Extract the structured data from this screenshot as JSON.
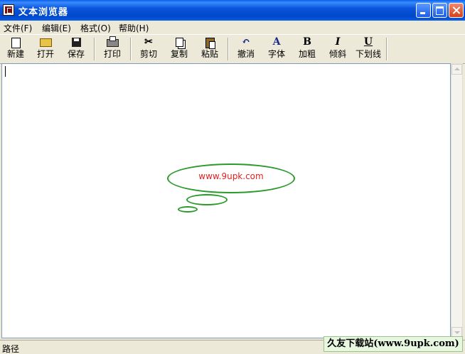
{
  "window": {
    "title": "文本浏览器",
    "icon": "app-icon"
  },
  "menubar": {
    "items": [
      {
        "label": "文件(F)"
      },
      {
        "label": "编辑(E)"
      },
      {
        "label": "格式(O)"
      },
      {
        "label": "帮助(H)"
      }
    ]
  },
  "toolbar": {
    "new": {
      "label": "新建",
      "icon": "new-file-icon"
    },
    "open": {
      "label": "打开",
      "icon": "open-folder-icon"
    },
    "save": {
      "label": "保存",
      "icon": "floppy-save-icon"
    },
    "print": {
      "label": "打印",
      "icon": "printer-icon"
    },
    "cut": {
      "label": "剪切",
      "icon": "scissors-icon",
      "glyph": "✂"
    },
    "copy": {
      "label": "复制",
      "icon": "copy-icon"
    },
    "paste": {
      "label": "粘贴",
      "icon": "paste-icon"
    },
    "undo": {
      "label": "撤消",
      "icon": "undo-icon",
      "glyph": "↶"
    },
    "font": {
      "label": "字体",
      "icon": "font-icon",
      "glyph": "A"
    },
    "bold": {
      "label": "加粗",
      "icon": "bold-icon",
      "glyph": "B"
    },
    "italic": {
      "label": "倾斜",
      "icon": "italic-icon",
      "glyph": "I"
    },
    "underline": {
      "label": "下划线",
      "icon": "underline-icon",
      "glyph": "U"
    }
  },
  "editor": {
    "watermark": "www.9upk.com"
  },
  "statusbar": {
    "path_label": "路径",
    "banner": "久友下载站(www.9upk.com)"
  },
  "colors": {
    "titlebar": "#0A55DC",
    "bubble_outline": "#2a9a2a",
    "watermark_text": "#e02020"
  }
}
